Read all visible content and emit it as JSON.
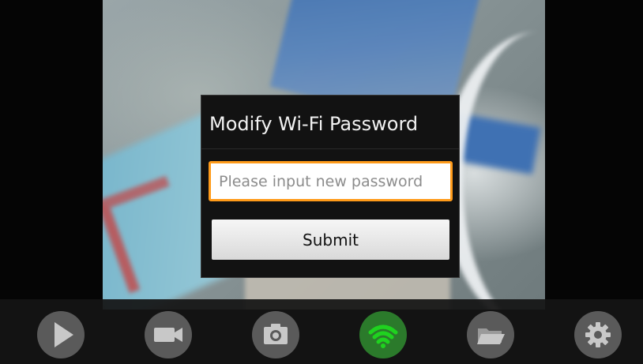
{
  "dialog": {
    "title": "Modify Wi-Fi Password",
    "password_placeholder": "Please input new password",
    "password_value": "",
    "submit_label": "Submit"
  },
  "toolbar": {
    "buttons": [
      {
        "icon": "play-icon",
        "active": false
      },
      {
        "icon": "video-camera-icon",
        "active": false
      },
      {
        "icon": "camera-icon",
        "active": false
      },
      {
        "icon": "wifi-icon",
        "active": true
      },
      {
        "icon": "folder-icon",
        "active": false
      },
      {
        "icon": "gear-icon",
        "active": false
      }
    ]
  },
  "colors": {
    "input_focus_border": "#ff9b1a",
    "wifi_active": "#2b7a2b",
    "wifi_icon": "#1fd21f",
    "toolbar_icon_bg": "#5a5a5a",
    "toolbar_icon_fg": "#c8c8c8"
  }
}
